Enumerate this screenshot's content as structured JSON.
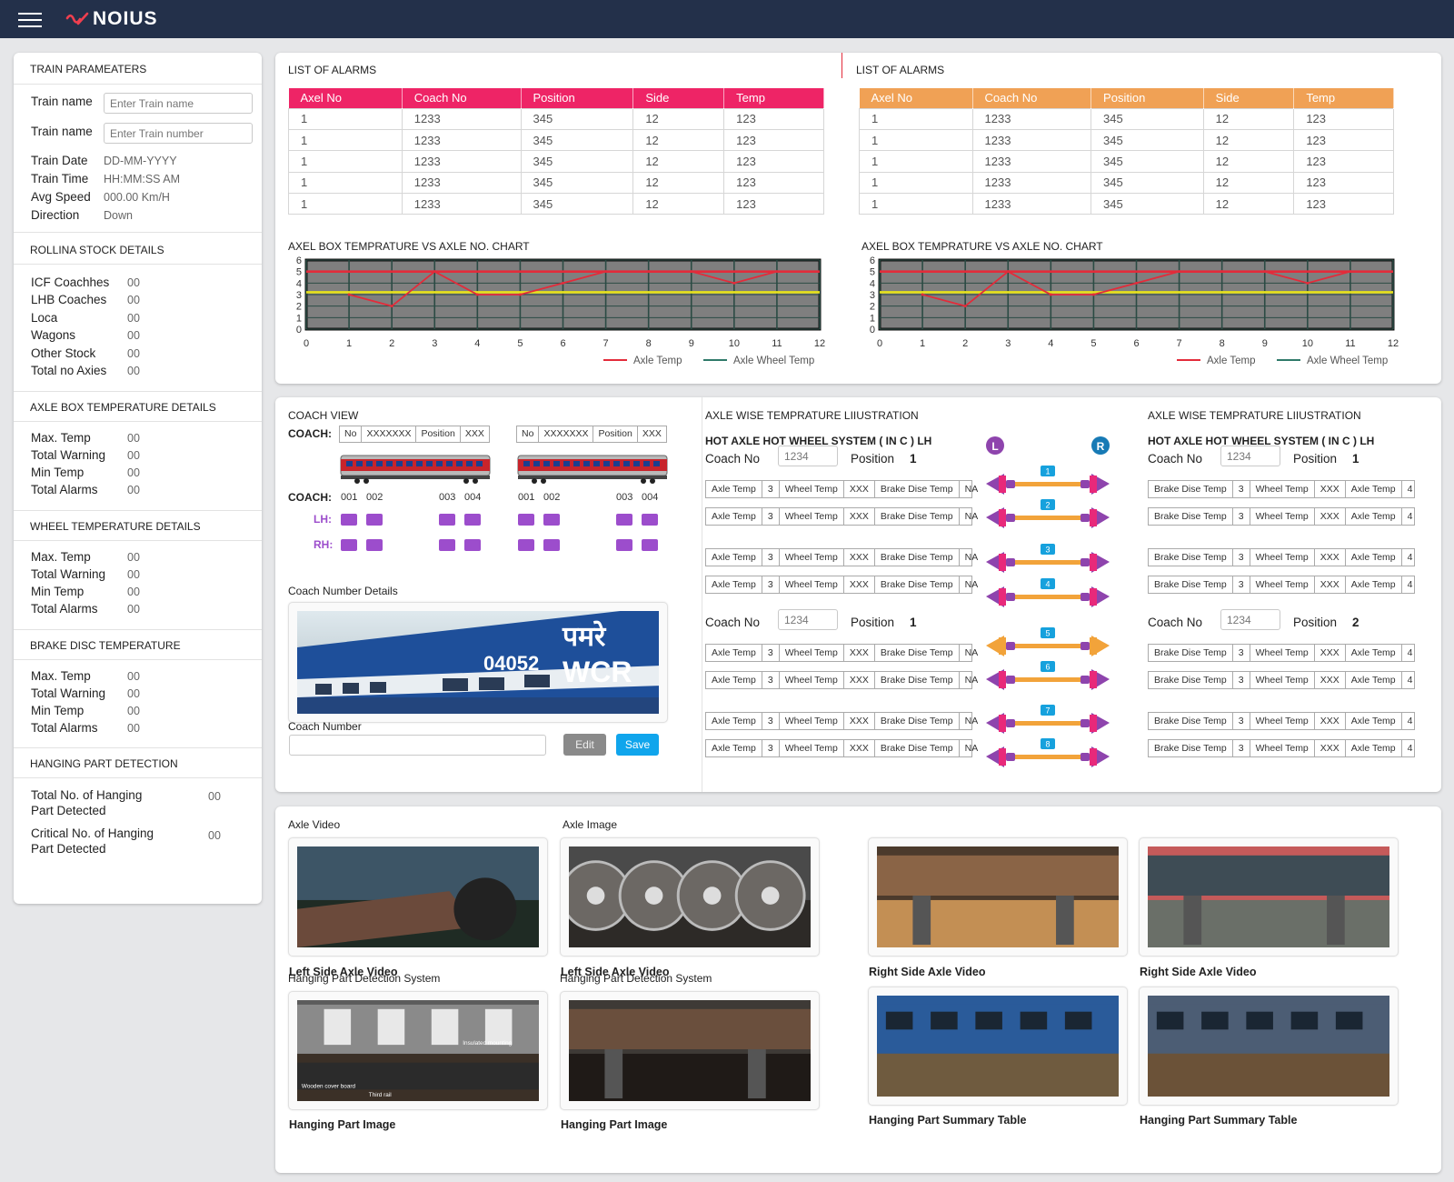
{
  "app": {
    "title": "NOIUS"
  },
  "train_params": {
    "title": "TRAIN PARAMEATERS",
    "name_label": "Train name",
    "name_placeholder": "Enter Train name",
    "number_label": "Train name",
    "number_placeholder": "Enter Train number",
    "date_label": "Train Date",
    "date_value": "DD-MM-YYYY",
    "time_label": "Train Time",
    "time_value": "HH:MM:SS AM",
    "speed_label": "Avg Speed",
    "speed_value": "000.00 Km/H",
    "direction_label": "Direction",
    "direction_value": "Down"
  },
  "rolling_stock": {
    "title": "ROLLINA STOCK DETAILS",
    "rows": [
      {
        "label": "ICF Coachhes",
        "value": "00"
      },
      {
        "label": "LHB Coaches",
        "value": "00"
      },
      {
        "label": "Loca",
        "value": "00"
      },
      {
        "label": "Wagons",
        "value": "00"
      },
      {
        "label": "Other Stock",
        "value": "00"
      },
      {
        "label": "Total no Axies",
        "value": "00"
      }
    ]
  },
  "axle_box": {
    "title": "AXLE BOX TEMPERATURE DETAILS",
    "rows": [
      {
        "label": "Max. Temp",
        "value": "00"
      },
      {
        "label": "Total Warning",
        "value": "00"
      },
      {
        "label": "Min Temp",
        "value": "00"
      },
      {
        "label": "Total Alarms",
        "value": "00"
      }
    ]
  },
  "wheel_temp": {
    "title": "WHEEL TEMPERATURE DETAILS",
    "rows": [
      {
        "label": "Max. Temp",
        "value": "00"
      },
      {
        "label": "Total Warning",
        "value": "00"
      },
      {
        "label": "Min Temp",
        "value": "00"
      },
      {
        "label": "Total Alarms",
        "value": "00"
      }
    ]
  },
  "brake_disc": {
    "title": "BRAKE DISC TEMPERATURE",
    "rows": [
      {
        "label": "Max. Temp",
        "value": "00"
      },
      {
        "label": "Total Warning",
        "value": "00"
      },
      {
        "label": "Min Temp",
        "value": "00"
      },
      {
        "label": "Total Alarms",
        "value": "00"
      }
    ]
  },
  "hanging": {
    "title": "HANGING PART DETECTION",
    "total_l1": "Total No. of Hanging",
    "total_l2": "Part Detected",
    "total_value": "00",
    "critical_l1": "Critical No. of Hanging",
    "critical_l2": "Part Detected",
    "critical_value": "00"
  },
  "alarms_left": {
    "title": "LIST OF ALARMS",
    "header_color": "#ee2466",
    "columns": [
      "Axel No",
      "Coach No",
      "Position",
      "Side",
      "Temp"
    ],
    "rows": [
      [
        "1",
        "1233",
        "345",
        "12",
        "123"
      ],
      [
        "1",
        "1233",
        "345",
        "12",
        "123"
      ],
      [
        "1",
        "1233",
        "345",
        "12",
        "123"
      ],
      [
        "1",
        "1233",
        "345",
        "12",
        "123"
      ],
      [
        "1",
        "1233",
        "345",
        "12",
        "123"
      ]
    ]
  },
  "alarms_right": {
    "title": "LIST OF ALARMS",
    "header_color": "#f0a155",
    "columns": [
      "Axel No",
      "Coach No",
      "Position",
      "Side",
      "Temp"
    ],
    "rows": [
      [
        "1",
        "1233",
        "345",
        "12",
        "123"
      ],
      [
        "1",
        "1233",
        "345",
        "12",
        "123"
      ],
      [
        "1",
        "1233",
        "345",
        "12",
        "123"
      ],
      [
        "1",
        "1233",
        "345",
        "12",
        "123"
      ],
      [
        "1",
        "1233",
        "345",
        "12",
        "123"
      ]
    ]
  },
  "chart_data": [
    {
      "type": "line",
      "title": "AXEL BOX TEMPRATURE VS AXLE NO. CHART",
      "x": [
        0,
        1,
        2,
        3,
        4,
        5,
        6,
        7,
        8,
        9,
        10,
        11,
        12
      ],
      "ylim": [
        0,
        6
      ],
      "xlim": [
        0,
        12
      ],
      "yticks": [
        0,
        1,
        2,
        3,
        4,
        5,
        6
      ],
      "series": [
        {
          "name": "Axle Temp",
          "color": "#e32b3a",
          "x": [
            1,
            2,
            3,
            4,
            5,
            6,
            7,
            8,
            9,
            10,
            11
          ],
          "values": [
            3,
            2,
            5,
            3,
            3,
            4,
            5,
            5,
            5,
            4,
            5
          ]
        },
        {
          "name": "Axle Wheel Temp",
          "color": "#2f7a6a",
          "x": [],
          "values": []
        }
      ],
      "threshold_lines": [
        {
          "value": 5,
          "color": "#e32b3a"
        },
        {
          "value": 3.2,
          "color": "#e7e21c"
        }
      ],
      "grid": true,
      "legend": "bottom-right"
    },
    {
      "type": "line",
      "title": "AXEL BOX TEMPRATURE VS AXLE NO. CHART",
      "x": [
        0,
        1,
        2,
        3,
        4,
        5,
        6,
        7,
        8,
        9,
        10,
        11,
        12
      ],
      "ylim": [
        0,
        6
      ],
      "xlim": [
        0,
        12
      ],
      "yticks": [
        0,
        1,
        2,
        3,
        4,
        5,
        6
      ],
      "series": [
        {
          "name": "Axle Temp",
          "color": "#e32b3a",
          "x": [
            1,
            2,
            3,
            4,
            5,
            6,
            7,
            8,
            9,
            10,
            11
          ],
          "values": [
            3,
            2,
            5,
            3,
            3,
            4,
            5,
            5,
            5,
            4,
            5
          ]
        },
        {
          "name": "Axle Wheel Temp",
          "color": "#2f7a6a",
          "x": [],
          "values": []
        }
      ],
      "threshold_lines": [
        {
          "value": 5,
          "color": "#e32b3a"
        },
        {
          "value": 3.2,
          "color": "#e7e21c"
        }
      ],
      "grid": true,
      "legend": "bottom-right"
    }
  ],
  "coach_view": {
    "title": "COACH VIEW",
    "coach_label": "COACH:",
    "header_cells": [
      "No",
      "XXXXXXX",
      "Position",
      "XXX"
    ],
    "coach_numbers": [
      "001",
      "002",
      "003",
      "004"
    ],
    "lh_label": "LH:",
    "rh_label": "RH:",
    "indicator_color": "#9c4dcc",
    "details_title": "Coach Number Details",
    "photo_text_number": "04052",
    "photo_text_hindi": "पमरे",
    "photo_text_code": "WCR",
    "coach_number_label": "Coach Number",
    "coach_number_value": "",
    "edit_label": "Edit",
    "save_label": "Save"
  },
  "axle_wise_left": {
    "title": "AXLE WISE TEMPRATURE LIIUSTRATION",
    "system": "HOT AXLE HOT WHEEL SYSTEM ( IN C ) LH",
    "coach_no_label": "Coach No",
    "groups": [
      {
        "coach_no": "1234",
        "position_label": "Position",
        "position": "1"
      },
      {
        "coach_no": "1234",
        "position_label": "Position",
        "position": "1"
      }
    ],
    "row": [
      "Axle Temp",
      "3",
      "Wheel Temp",
      "XXX",
      "Brake Dise Temp",
      "NA"
    ]
  },
  "axle_wise_right": {
    "title": "AXLE WISE TEMPRATURE LIIUSTRATION",
    "system": "HOT AXLE HOT WHEEL SYSTEM ( IN C ) LH",
    "coach_no_label": "Coach No",
    "groups": [
      {
        "coach_no": "1234",
        "position_label": "Position",
        "position": "1"
      },
      {
        "coach_no": "1234",
        "position_label": "Position",
        "position": "2"
      }
    ],
    "row": [
      "Brake Dise Temp",
      "3",
      "Wheel Temp",
      "XXX",
      "Axle Temp",
      "4"
    ]
  },
  "axle_illustration": {
    "left_badge": "L",
    "right_badge": "R",
    "axles": [
      "1",
      "2",
      "3",
      "4",
      "5",
      "6",
      "7",
      "8"
    ],
    "colors": {
      "pink": "#e8297a",
      "orange": "#f2a33a",
      "purple": "#8e44ad",
      "blue": "#16a1dd"
    }
  },
  "media": {
    "axle_video_title": "Axle Video",
    "axle_image_title": "Axle Image",
    "captions_row1": [
      "Left Side Axle Video",
      "Left Side Axle Video",
      "Right Side Axle Video",
      "Right Side Axle Video"
    ],
    "hanging_titles": [
      "Hanging Part Detection System",
      "Hanging Part Detection System"
    ],
    "captions_row2": [
      "Hanging Part Image",
      "Hanging Part Image",
      "Hanging Part Summary Table",
      "Hanging Part Summary Table"
    ],
    "annotations": [
      "Insulated mounting",
      "Wooden cover board",
      "Third rail"
    ]
  }
}
